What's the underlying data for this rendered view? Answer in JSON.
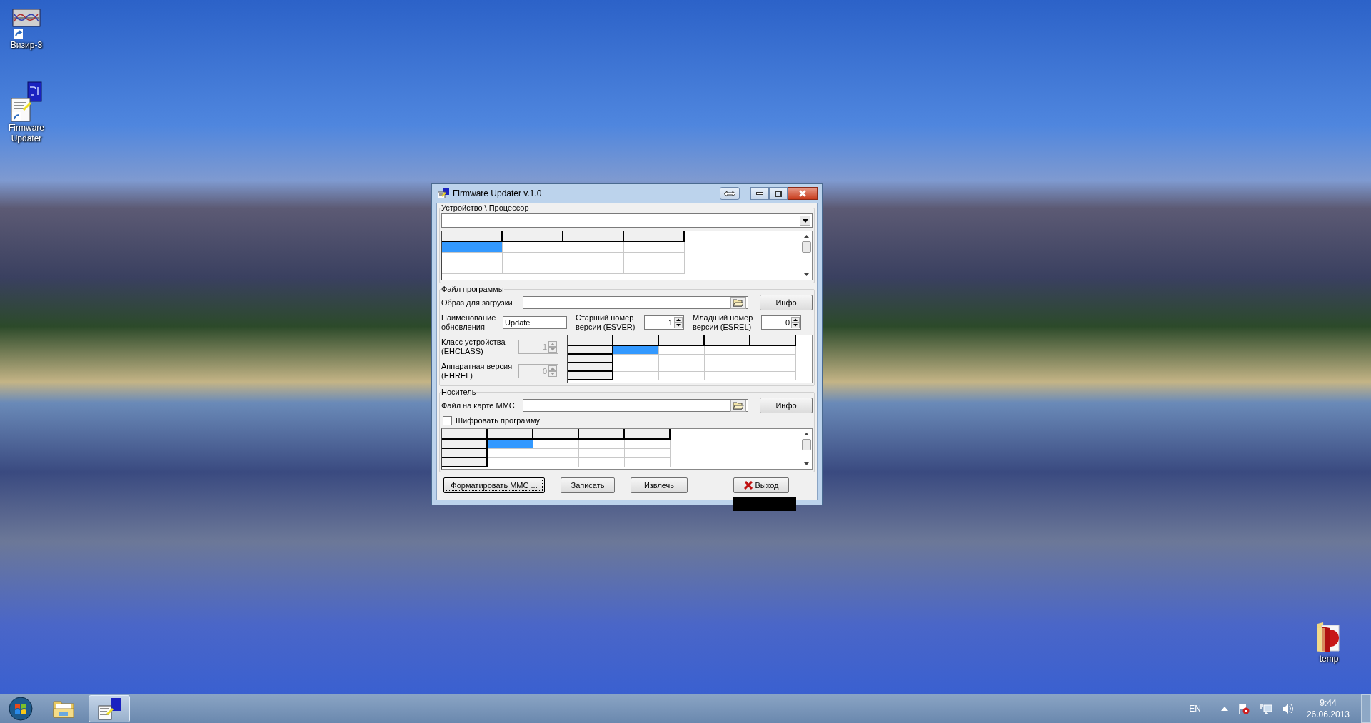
{
  "desktop": {
    "icons": [
      {
        "kind": "chart",
        "label": "Визир-3"
      },
      {
        "kind": "sd",
        "label": "Firmware Updater"
      },
      {
        "kind": "folder",
        "label": "temp"
      }
    ]
  },
  "window": {
    "title": "Firmware Updater v.1.0",
    "device_group": {
      "title": "Устройство \\ Процессор",
      "grid": {
        "fixed_column": false,
        "rows": [
          {
            "cells": [
              {
                "selected": true
              },
              {
                "selected": false
              },
              {
                "selected": false
              },
              {
                "selected": false
              }
            ]
          },
          {
            "cells": [
              {
                "selected": false
              },
              {
                "selected": false
              },
              {
                "selected": false
              },
              {
                "selected": false
              }
            ]
          },
          {
            "cells": [
              {
                "selected": false
              },
              {
                "selected": false
              },
              {
                "selected": false
              },
              {
                "selected": false
              }
            ]
          }
        ]
      }
    },
    "program_group": {
      "title": "Файл программы",
      "image_label": "Образ для загрузки",
      "info_button": "Инфо",
      "update_name": {
        "label": "Наименование обновления",
        "value": "Update"
      },
      "esver": {
        "label": "Старший номер версии (ESVER)",
        "value": "1",
        "disabled": false
      },
      "esrel": {
        "label": "Младший номер версии (ESREL)",
        "value": "0",
        "disabled": false
      },
      "ehclass": {
        "label": "Класс устройства (EHCLASS)",
        "value": "1",
        "disabled": true
      },
      "ehrel": {
        "label": "Аппаратная версия (EHREL)",
        "value": "0",
        "disabled": true
      },
      "grid": {
        "fixed_column": true,
        "rows": [
          {
            "cells": [
              {
                "selected": true
              },
              {
                "selected": false
              },
              {
                "selected": false
              },
              {
                "selected": false
              }
            ]
          },
          {
            "cells": [
              {
                "selected": false
              },
              {
                "selected": false
              },
              {
                "selected": false
              },
              {
                "selected": false
              }
            ]
          },
          {
            "cells": [
              {
                "selected": false
              },
              {
                "selected": false
              },
              {
                "selected": false
              },
              {
                "selected": false
              }
            ]
          },
          {
            "cells": [
              {
                "selected": false
              },
              {
                "selected": false
              },
              {
                "selected": false
              },
              {
                "selected": false
              }
            ]
          }
        ]
      }
    },
    "media_group": {
      "title": "Носитель",
      "file_label": "Файл на карте MMC",
      "info_button": "Инфо",
      "encrypt": {
        "label": "Шифровать программу",
        "checked": false
      },
      "grid": {
        "fixed_column": true,
        "rows": [
          {
            "cells": [
              {
                "selected": true
              },
              {
                "selected": false
              },
              {
                "selected": false
              },
              {
                "selected": false
              }
            ]
          },
          {
            "cells": [
              {
                "selected": false
              },
              {
                "selected": false
              },
              {
                "selected": false
              },
              {
                "selected": false
              }
            ]
          },
          {
            "cells": [
              {
                "selected": false
              },
              {
                "selected": false
              },
              {
                "selected": false
              },
              {
                "selected": false
              }
            ]
          }
        ]
      }
    },
    "buttons": [
      {
        "kind": "format",
        "label": "Форматировать MMC ...",
        "focused": true
      },
      {
        "kind": "write",
        "label": "Записать",
        "focused": false
      },
      {
        "kind": "extract",
        "label": "Извлечь",
        "focused": false
      },
      {
        "kind": "exit",
        "label": "Выход",
        "focused": false
      }
    ]
  },
  "taskbar": {
    "buttons": [
      {
        "kind": "start"
      },
      {
        "kind": "explorer",
        "selected": false
      },
      {
        "kind": "app",
        "selected": true
      }
    ],
    "tray": {
      "language": "EN",
      "time": "9:44",
      "date": "26.06.2013"
    }
  }
}
